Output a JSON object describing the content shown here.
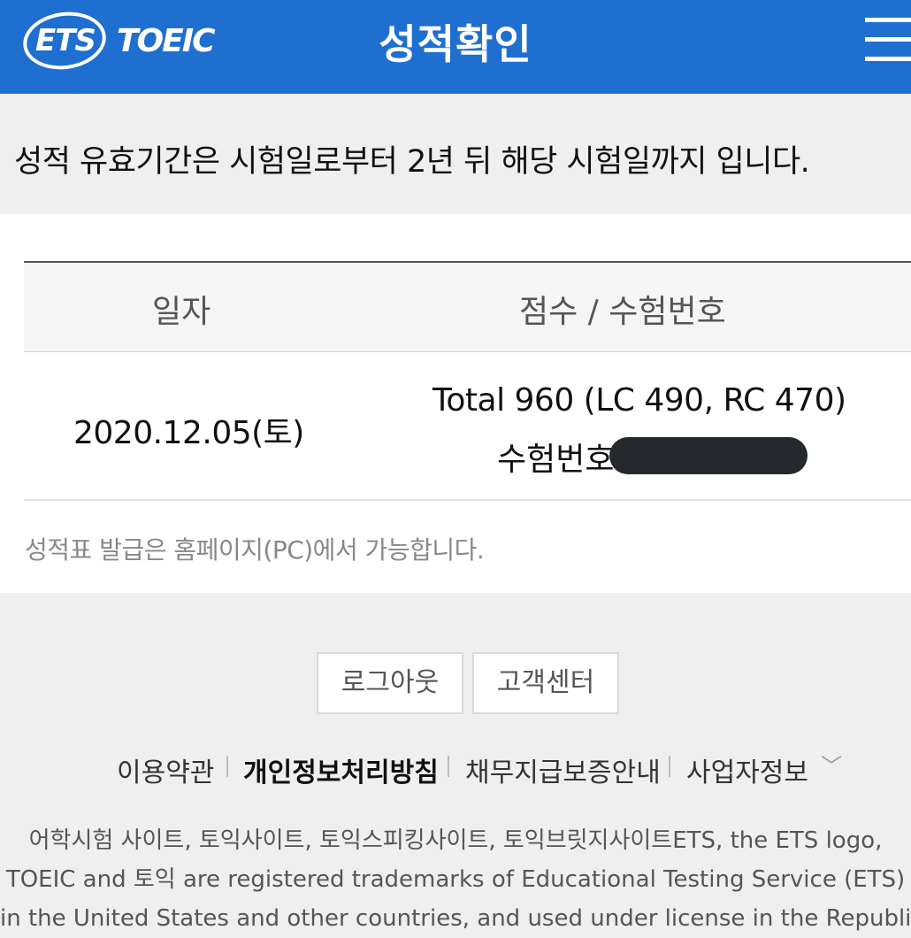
{
  "header": {
    "logo_ets": "ETS",
    "logo_toeic": "TOEIC",
    "title": "성적확인"
  },
  "notice": {
    "text": "성적 유효기간은 시험일로부터 2년 뒤 해당 시험일까지 입니다."
  },
  "table": {
    "headers": [
      "일자",
      "점수 / 수험번호"
    ],
    "rows": [
      {
        "date": "2020.12.05(토)",
        "total": "Total 960 (LC 490, RC 470)",
        "exam_label": "수험번호"
      }
    ]
  },
  "issue_note": "성적표 발급은 홈페이지(PC)에서 가능합니다.",
  "buttons": {
    "logout": "로그아웃",
    "customer_center": "고객센터"
  },
  "footer": {
    "links": [
      "이용약관",
      "개인정보처리방침",
      "채무지급보증안내",
      "사업자정보"
    ],
    "legal_lines": [
      "어학시험 사이트, 토익사이트, 토익스피킹사이트, 토익브릿지사이트ETS, the ETS logo,",
      "TOEIC and 토익 are registered trademarks of Educational Testing Service (ETS)",
      "in the United States and other countries, and used under license in the Republic"
    ]
  },
  "colors": {
    "brand": "#1f6fd1",
    "background": "#efefef"
  },
  "icons": [
    "menu-icon",
    "chevron-down-icon"
  ]
}
